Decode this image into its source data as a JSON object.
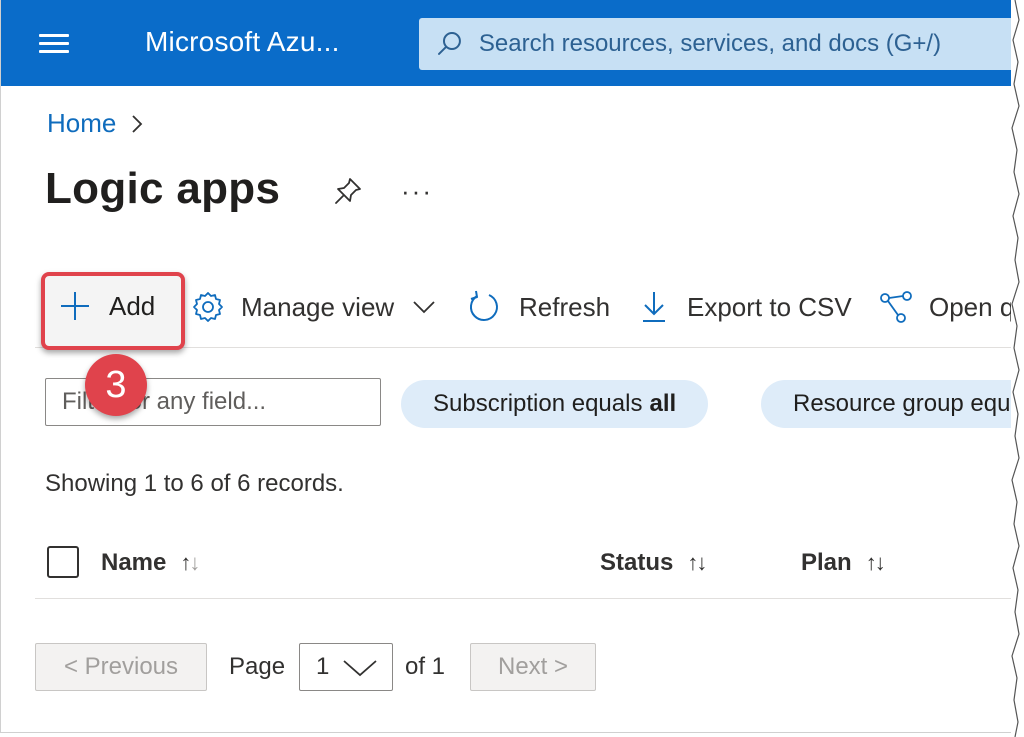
{
  "header": {
    "brand": "Microsoft Azu...",
    "search_placeholder": "Search resources, services, and docs (G+/)"
  },
  "breadcrumb": {
    "home": "Home",
    "separator": ">"
  },
  "page": {
    "title": "Logic apps",
    "more": "···"
  },
  "toolbar": {
    "add": "Add",
    "manage_view": "Manage view",
    "refresh": "Refresh",
    "export": "Export to CSV",
    "open": "Open q"
  },
  "step_badge": "3",
  "filters": {
    "placeholder": "Filter for any field...",
    "subscription_prefix": "Subscription equals",
    "subscription_value": "all",
    "resource_group": "Resource group equals all"
  },
  "records_text": "Showing 1 to 6 of 6 records.",
  "table": {
    "columns": [
      "Name",
      "Status",
      "Plan"
    ]
  },
  "pagination": {
    "previous": "< Previous",
    "page_label": "Page",
    "current_page": "1",
    "of_label": "of 1",
    "next": "Next >"
  },
  "colors": {
    "topbar": "#0a6cc9",
    "link": "#0f6cbd",
    "highlight": "#e0434c",
    "pill": "#deecf9"
  },
  "icons": [
    "menu-icon",
    "search-icon",
    "chevron-right-icon",
    "pin-icon",
    "plus-icon",
    "gear-icon",
    "chevron-down-icon",
    "refresh-icon",
    "download-icon",
    "share-graph-icon",
    "sort-icon"
  ]
}
